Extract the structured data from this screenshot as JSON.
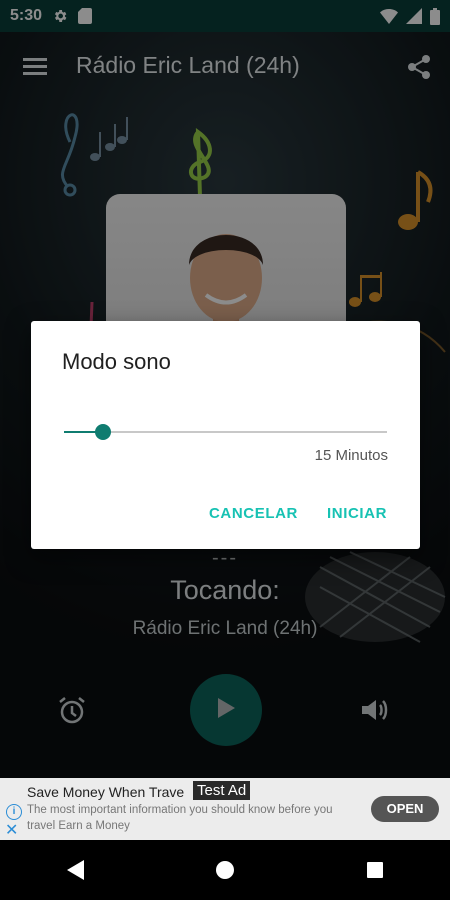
{
  "status_bar": {
    "time": "5:30",
    "icons": [
      "settings-icon",
      "sim-card-icon",
      "wifi-icon",
      "signal-icon",
      "battery-icon"
    ]
  },
  "app": {
    "title": "Rádio Eric Land (24h)",
    "menu_icon": "hamburger-menu-icon",
    "share_icon": "share-icon",
    "track_placeholder": "---",
    "now_playing_label": "Tocando:",
    "station_name": "Rádio Eric Land (24h)",
    "controls": {
      "alarm_icon": "alarm-clock-icon",
      "play_icon": "play-icon",
      "volume_icon": "volume-icon"
    }
  },
  "dialog": {
    "title": "Modo sono",
    "slider_fraction": 0.12,
    "slider_value_text": "15 Minutos",
    "cancel_label": "CANCELAR",
    "start_label": "INICIAR"
  },
  "ad": {
    "title": "Save Money When Trave",
    "tag": "Test Ad",
    "description": "The most important information you should know before you travel Earn a Money",
    "button": "OPEN"
  },
  "nav_bar": {
    "icons": [
      "back-icon",
      "home-icon",
      "recents-icon"
    ]
  },
  "colors": {
    "accent": "#0f7c70",
    "dialog_button_text": "#17c2b3",
    "status_bar": "#0a3f3a"
  }
}
